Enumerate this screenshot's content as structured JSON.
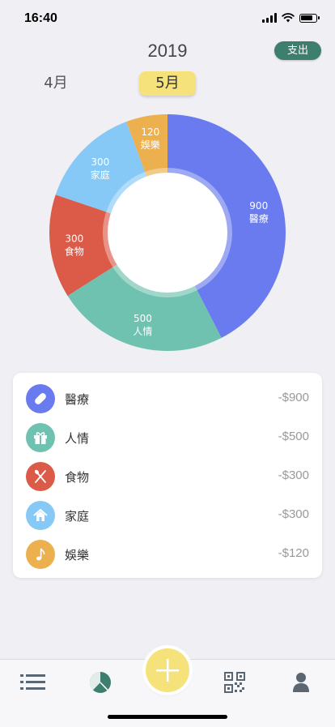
{
  "status": {
    "time": "16:40"
  },
  "header": {
    "year": "2019",
    "mode_label": "支出",
    "prev_month": "4月",
    "current_month": "5月"
  },
  "colors": {
    "medical": "#6a7bef",
    "social": "#6fc2b0",
    "food": "#dc5a48",
    "home": "#86c9f6",
    "fun": "#ecb04e",
    "accent": "#3e7e6e",
    "highlight": "#f6e27a"
  },
  "chart_data": {
    "type": "pie",
    "slices": [
      {
        "name": "醫療",
        "value": 900,
        "color": "#6a7bef"
      },
      {
        "name": "人情",
        "value": 500,
        "color": "#6fc2b0"
      },
      {
        "name": "食物",
        "value": 300,
        "color": "#dc5a48"
      },
      {
        "name": "家庭",
        "value": 300,
        "color": "#86c9f6"
      },
      {
        "name": "娛樂",
        "value": 120,
        "color": "#ecb04e"
      }
    ]
  },
  "list": {
    "items": [
      {
        "name": "醫療",
        "amount": "-$900",
        "icon": "pill-icon",
        "color": "#6a7bef"
      },
      {
        "name": "人情",
        "amount": "-$500",
        "icon": "gift-icon",
        "color": "#6fc2b0"
      },
      {
        "name": "食物",
        "amount": "-$300",
        "icon": "utensils-icon",
        "color": "#dc5a48"
      },
      {
        "name": "家庭",
        "amount": "-$300",
        "icon": "house-icon",
        "color": "#86c9f6"
      },
      {
        "name": "娛樂",
        "amount": "-$120",
        "icon": "music-note-icon",
        "color": "#ecb04e"
      }
    ]
  },
  "tabbar": {
    "items": [
      "list-icon",
      "chart-icon",
      "plus-icon",
      "qr-code-icon",
      "person-icon"
    ]
  }
}
